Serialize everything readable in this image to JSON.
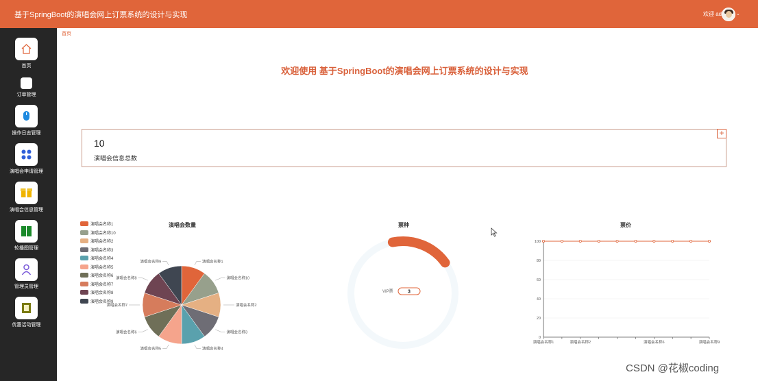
{
  "header": {
    "title": "基于SpringBoot的演唱会网上订票系统的设计与实现",
    "user_label": "欢迎 admin"
  },
  "sidebar": {
    "items": [
      {
        "label": "首页",
        "icon": "home-icon"
      },
      {
        "label": "订单管理",
        "icon": "order-icon"
      },
      {
        "label": "操作日志管理",
        "icon": "log-icon"
      },
      {
        "label": "演唱会申请管理",
        "icon": "apply-icon"
      },
      {
        "label": "演唱会信息管理",
        "icon": "info-icon"
      },
      {
        "label": "轮播图管理",
        "icon": "carousel-icon"
      },
      {
        "label": "管理员管理",
        "icon": "admin-icon"
      },
      {
        "label": "优惠活动管理",
        "icon": "promo-icon"
      }
    ]
  },
  "breadcrumb": "首页",
  "welcome": "欢迎使用 基于SpringBoot的演唱会网上订票系统的设计与实现",
  "stat": {
    "value": "10",
    "label": "演唱会信息总数",
    "expand": "+"
  },
  "colors": {
    "accent": "#e0653a",
    "sidebar": "#262626"
  },
  "chart_data": [
    {
      "type": "pie",
      "title": "演唱会数量",
      "legend_position": "left",
      "categories": [
        "演唱会名称1",
        "演唱会名称10",
        "演唱会名称2",
        "演唱会名称3",
        "演唱会名称4",
        "演唱会名称5",
        "演唱会名称6",
        "演唱会名称7",
        "演唱会名称8",
        "演唱会名称9"
      ],
      "values": [
        1,
        1,
        1,
        1,
        1,
        1,
        1,
        1,
        1,
        1
      ],
      "colors": [
        "#e0653a",
        "#97a08c",
        "#e5b083",
        "#6e6d75",
        "#5aa1ad",
        "#f5a48c",
        "#6f6f58",
        "#d67c5c",
        "#6e4452",
        "#3f4651"
      ]
    },
    {
      "type": "gauge",
      "title": "票种",
      "categories": [
        "VIP票"
      ],
      "values": [
        3
      ],
      "max": 20
    },
    {
      "type": "line",
      "title": "票价",
      "categories": [
        "演唱会名称1",
        "演唱会名称10",
        "演唱会名称2",
        "演唱会名称3",
        "演唱会名称4",
        "演唱会名称5",
        "演唱会名称6",
        "演唱会名称7",
        "演唱会名称8",
        "演唱会名称9"
      ],
      "x_tick_labels": [
        "演唱会名称1",
        "演唱会名称2",
        "演唱会名称6",
        "演唱会名称9"
      ],
      "values": [
        100,
        100,
        100,
        100,
        100,
        100,
        100,
        100,
        100,
        100
      ],
      "ylim": [
        0,
        100
      ],
      "yticks": [
        0,
        20,
        40,
        60,
        80,
        100
      ],
      "grid": true
    }
  ],
  "watermark": "CSDN @花椒coding"
}
